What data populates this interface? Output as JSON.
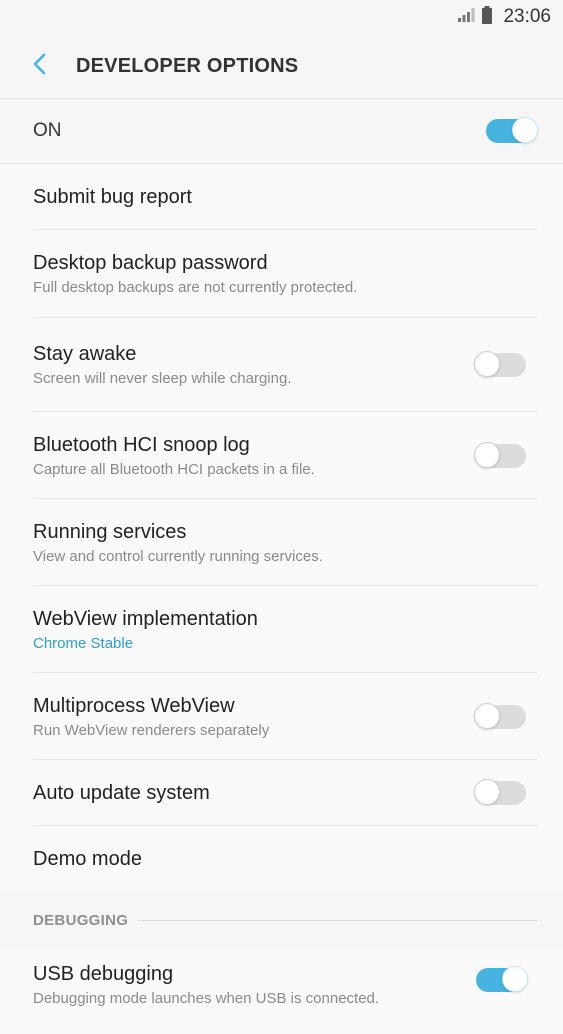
{
  "status_bar": {
    "time": "23:06"
  },
  "header": {
    "title": "DEVELOPER OPTIONS"
  },
  "master": {
    "label": "ON",
    "on": true
  },
  "items": [
    {
      "title": "Submit bug report",
      "summary": ""
    },
    {
      "title": "Desktop backup password",
      "summary": "Full desktop backups are not currently protected."
    },
    {
      "title": "Stay awake",
      "summary": "Screen will never sleep while charging.",
      "toggle": "off"
    },
    {
      "title": "Bluetooth HCI snoop log",
      "summary": "Capture all Bluetooth HCI packets in a file.",
      "toggle": "off"
    },
    {
      "title": "Running services",
      "summary": "View and control currently running services."
    },
    {
      "title": "WebView implementation",
      "summary": "Chrome Stable"
    },
    {
      "title": "Multiprocess WebView",
      "summary": "Run WebView renderers separately",
      "toggle": "off"
    },
    {
      "title": "Auto update system",
      "summary": "",
      "toggle": "off"
    },
    {
      "title": "Demo mode",
      "summary": ""
    }
  ],
  "debugging": {
    "header": "DEBUGGING",
    "usb": {
      "title": "USB debugging",
      "summary": "Debugging mode launches when USB is connected.",
      "toggle": "on"
    }
  },
  "colors": {
    "accent": "#47b3e0",
    "accent_text": "#2d9fc4",
    "back_arrow": "#47b3e0"
  }
}
